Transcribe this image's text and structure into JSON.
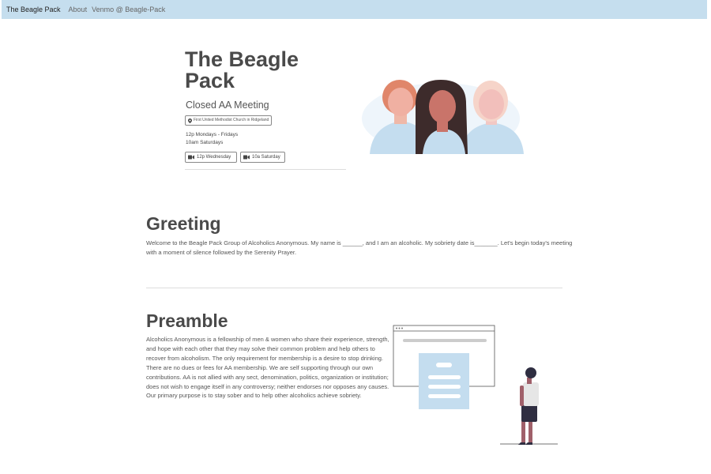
{
  "nav": {
    "brand": "The Beagle Pack",
    "about": "About",
    "venmo": "Venmo @ Beagle-Pack"
  },
  "hero": {
    "title_line1": "The Beagle",
    "title_line2": "Pack",
    "subtitle": "Closed AA Meeting",
    "location": "First United Methodist Church in Ridgeland",
    "schedule_line1": "12p Mondays - Fridays",
    "schedule_line2": "10am Saturdays",
    "button_wednesday": "12p Wednesday",
    "button_saturday": "10a Saturday",
    "location_icon": "map-pin-icon",
    "video_icon": "video-camera-icon"
  },
  "greeting": {
    "title": "Greeting",
    "text": "Welcome to the Beagle Pack Group of Alcoholics Anonymous. My name is ______, and I am an alcoholic. My sobriety date is_______. Let's begin today's meeting with a moment of silence followed by the Serenity Prayer."
  },
  "preamble": {
    "title": "Preamble",
    "text": "Alcoholics Anonymous is a fellowship of men & women who share their experience, strength, and hope with each other that they may solve their common problem and help others to recover from alcoholism. The only requirement for membership is a desire to stop drinking. There are no dues or fees for AA membership. We are self supporting through our own contributions. AA is not allied with any sect, denomination, politics, organization or institution; does not wish to engage itself in any controversy; neither endorses nor opposes any causes. Our primary purpose is to stay sober and to help other alcoholics achieve sobriety."
  },
  "colors": {
    "navbar_bg": "#c5deee",
    "illustration_blue": "#c4ddef",
    "heading": "#4a4a4a"
  }
}
